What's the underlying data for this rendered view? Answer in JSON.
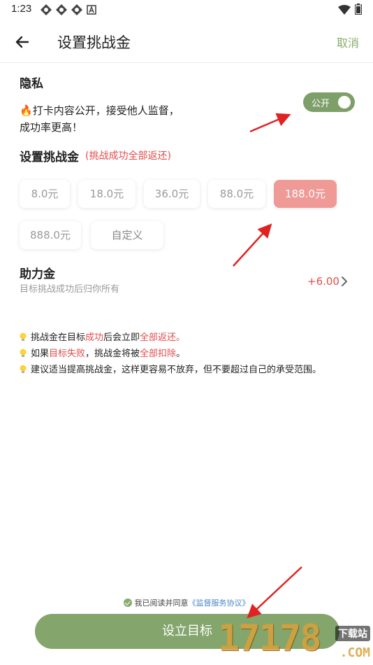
{
  "status_bar": {
    "time": "1:23"
  },
  "header": {
    "title": "设置挑战金",
    "cancel_label": "取消"
  },
  "privacy": {
    "title": "隐私",
    "description_line1": "打卡内容公开，接受他人监督，",
    "description_line2": "成功率更高！",
    "toggle_label": "公开",
    "toggle_on": true
  },
  "deposit": {
    "title": "设置挑战金",
    "note": "(挑战成功全部返还)",
    "options": [
      {
        "label": "8.0元",
        "selected": false
      },
      {
        "label": "18.0元",
        "selected": false
      },
      {
        "label": "36.0元",
        "selected": false
      },
      {
        "label": "88.0元",
        "selected": false
      },
      {
        "label": "188.0元",
        "selected": true
      },
      {
        "label": "888.0元",
        "selected": false
      },
      {
        "label": "自定义",
        "selected": false
      }
    ]
  },
  "assist": {
    "title": "助力金",
    "subtitle": "目标挑战成功后归你所有",
    "value": "+6.00"
  },
  "tips": [
    {
      "parts": [
        {
          "text": "挑战金在目标",
          "red": false
        },
        {
          "text": "成功",
          "red": true
        },
        {
          "text": "后会立即",
          "red": false
        },
        {
          "text": "全部返还。",
          "red": true
        }
      ]
    },
    {
      "parts": [
        {
          "text": "如果",
          "red": false
        },
        {
          "text": "目标失败",
          "red": true
        },
        {
          "text": "，挑战金将被",
          "red": false
        },
        {
          "text": "全部扣除",
          "red": true
        },
        {
          "text": "。",
          "red": false
        }
      ]
    },
    {
      "parts": [
        {
          "text": "建议适当提高挑战金，这样更容易不放弃，但不要超过自己的承受范围。",
          "red": false
        }
      ]
    }
  ],
  "agreement": {
    "text": "我已阅读并同意",
    "link": "《监督服务协议》"
  },
  "submit_label": "设立目标",
  "watermark": {
    "number": "17178",
    "tag": "下载站",
    "domain": ".COM"
  },
  "colors": {
    "accent_green": "#84a56c",
    "selected_chip": "#ef9a96",
    "alert_red": "#e24c4c",
    "link_blue": "#4a86c8"
  }
}
